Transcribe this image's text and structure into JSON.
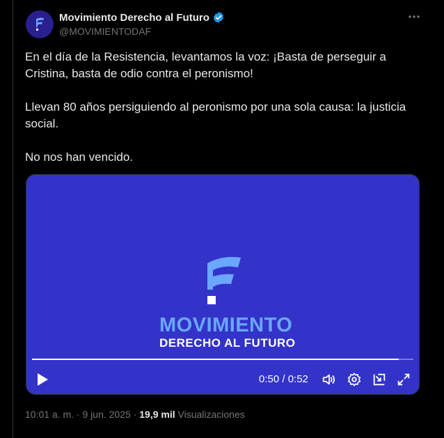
{
  "author": {
    "display_name": "Movimiento Derecho al Futuro",
    "handle": "@MOVIMIENTODAF",
    "verified": true,
    "avatar_icon": "f-logo-icon",
    "avatar_bg": "#2a1f8f"
  },
  "tweet": {
    "paragraphs": [
      "En el día de la Resistencia, levantamos la voz: ¡Basta de perseguir a Cristina, basta de odio contra el peronismo!",
      "Llevan 80 años persiguiendo al peronismo por una sola causa: la justicia social.",
      "No nos han vencido."
    ]
  },
  "video": {
    "background": "#3333c9",
    "brand_line_1": "MOVIMIENTO",
    "brand_line_2": "DERECHO AL FUTURO",
    "progress": 0.962,
    "time_display": "0:50 / 0:52",
    "controls": [
      "play-icon",
      "volume-icon",
      "settings-icon",
      "pip-icon",
      "fullscreen-icon"
    ]
  },
  "meta": {
    "time": "10:01 a. m.",
    "date": "9 jun. 2025",
    "views_count": "19,9 mil",
    "views_label": "Visualizaciones"
  },
  "colors": {
    "accent_verified": "#1d9bf0",
    "brand_light_blue": "#6aa7ff",
    "text_primary": "#e7e9ea",
    "text_secondary": "#71767b"
  }
}
